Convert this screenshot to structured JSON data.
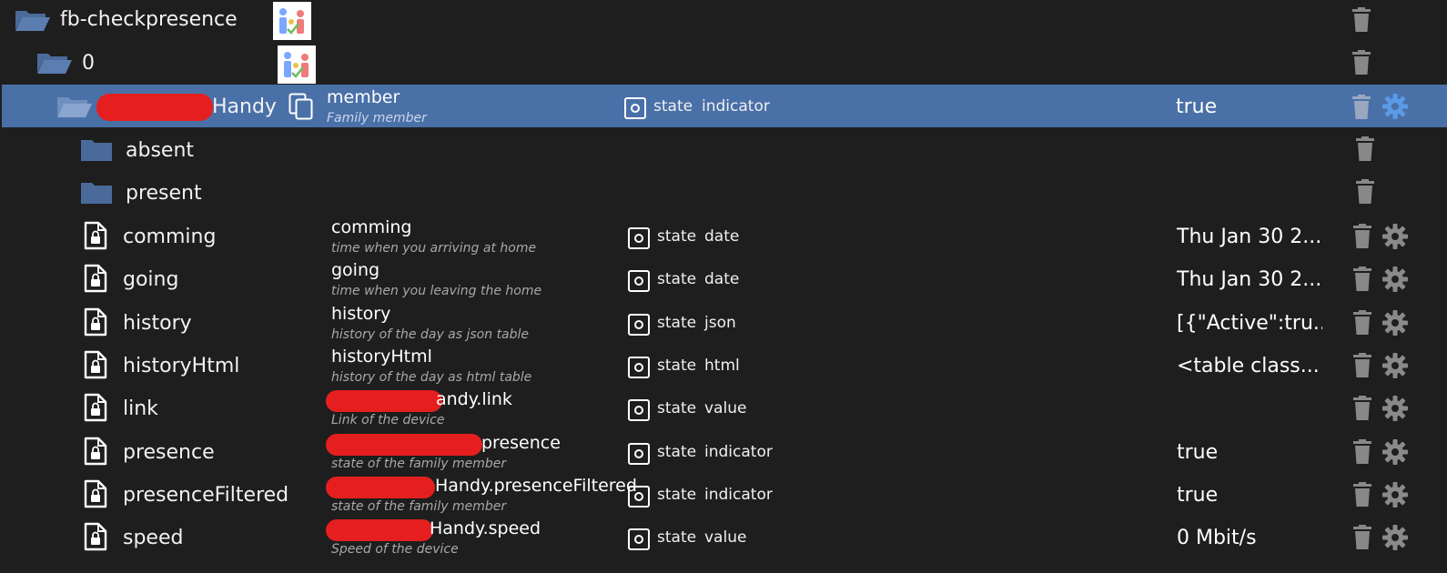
{
  "tree": {
    "adapter": {
      "name": "fb-checkpresence",
      "icon": "adapter-logo-icon"
    },
    "instance": {
      "name": "0",
      "icon": "adapter-logo-icon"
    },
    "device": {
      "name": "Handy",
      "title": "member",
      "description": "Family member",
      "type": "state",
      "role": "indicator",
      "value": "true"
    },
    "folders": [
      {
        "name": "absent"
      },
      {
        "name": "present"
      }
    ],
    "states": [
      {
        "name": "comming",
        "title": "comming",
        "description": "time when you arriving at home",
        "type": "state",
        "role": "date",
        "value": "Thu Jan 30 2..."
      },
      {
        "name": "going",
        "title": "going",
        "description": "time when you leaving the home",
        "type": "state",
        "role": "date",
        "value": "Thu Jan 30 2..."
      },
      {
        "name": "history",
        "title": "history",
        "description": "history of the day as json table",
        "type": "state",
        "role": "json",
        "value": "[{\"Active\":tru..."
      },
      {
        "name": "historyHtml",
        "title": "historyHtml",
        "description": "history of the day as html table",
        "type": "state",
        "role": "html",
        "value": "<table class..."
      },
      {
        "name": "link",
        "title": "andy.link",
        "description": "Link of the device",
        "type": "state",
        "role": "value",
        "value": ""
      },
      {
        "name": "presence",
        "title": "presence",
        "description": "state of the family member",
        "type": "state",
        "role": "indicator",
        "value": "true"
      },
      {
        "name": "presenceFiltered",
        "title": "Handy.presenceFiltered",
        "description": "state of the family member",
        "type": "state",
        "role": "indicator",
        "value": "true"
      },
      {
        "name": "speed",
        "title": "Handy.speed",
        "description": "Speed of the device",
        "type": "state",
        "role": "value",
        "value": "0 Mbit/s"
      }
    ]
  },
  "colors": {
    "background": "#1e1e1e",
    "selected_row": "#4a70a8",
    "folder": "#4a6a9a",
    "action_icon": "#888888",
    "redaction": "#e51f1f"
  }
}
